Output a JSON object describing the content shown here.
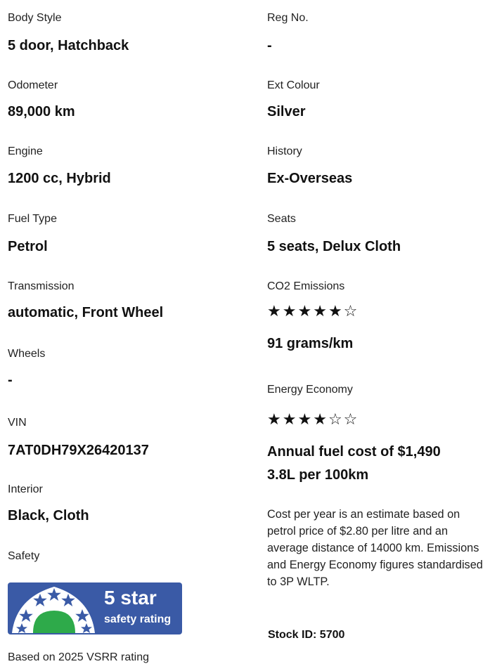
{
  "left": {
    "body_style": {
      "label": "Body Style",
      "value": "5 door, Hatchback"
    },
    "odometer": {
      "label": "Odometer",
      "value": "89,000 km"
    },
    "engine": {
      "label": "Engine",
      "value": "1200 cc, Hybrid"
    },
    "fuel_type": {
      "label": "Fuel Type",
      "value": "Petrol"
    },
    "transmission": {
      "label": "Transmission",
      "value": "automatic, Front Wheel"
    },
    "wheels": {
      "label": "Wheels",
      "value": "-"
    },
    "vin": {
      "label": "VIN",
      "value": "7AT0DH79X26420137"
    },
    "interior": {
      "label": "Interior",
      "value": "Black, Cloth"
    },
    "safety": {
      "label": "Safety",
      "badge_line1": "5 star",
      "badge_line2": "safety rating",
      "stars": 5,
      "footnote": "Based on 2025 VSRR rating",
      "badge_color": "#3a5aa6"
    }
  },
  "right": {
    "reg_no": {
      "label": "Reg No.",
      "value": "-"
    },
    "ext_colour": {
      "label": "Ext Colour",
      "value": "Silver"
    },
    "history": {
      "label": "History",
      "value": "Ex-Overseas"
    },
    "seats": {
      "label": "Seats",
      "value": "5 seats, Delux Cloth"
    },
    "co2": {
      "label": "CO2 Emissions",
      "stars_filled": 5,
      "stars_total": 6,
      "value": "91 grams/km"
    },
    "energy": {
      "label": "Energy Economy",
      "stars_filled": 4,
      "stars_total": 6,
      "annual_cost": "Annual fuel cost of $1,490",
      "consumption": "3.8L per 100km"
    },
    "note": "Cost per year is an estimate based on petrol price of  $2.80 per litre and an average distance of 14000 km. Emissions and Energy Economy figures standardised to 3P WLTP.",
    "stock_id": "Stock ID: 5700"
  }
}
